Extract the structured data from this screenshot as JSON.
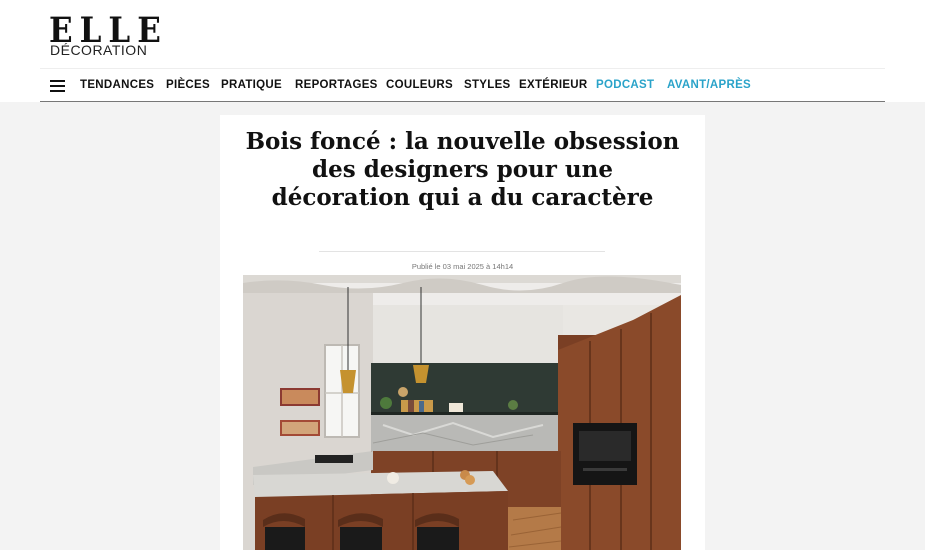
{
  "logo": {
    "main": "ELLE",
    "sub": "DÉCORATION"
  },
  "nav": {
    "menu_icon": "hamburger-menu-icon",
    "items": [
      "TENDANCES",
      "PIÈCES",
      "PRATIQUE",
      "REPORTAGES",
      "COULEURS",
      "STYLES",
      "EXTÉRIEUR",
      "PODCAST",
      "AVANT/APRÈS"
    ],
    "accent_color": "#2aa3c9"
  },
  "article": {
    "title": "Bois foncé : la nouvelle obsession des designers pour une décoration qui a du caractère",
    "published": "Publié le 03 mai 2025 à 14h14"
  },
  "colors": {
    "page_background": "#f3f3f3",
    "card_background": "#ffffff"
  }
}
